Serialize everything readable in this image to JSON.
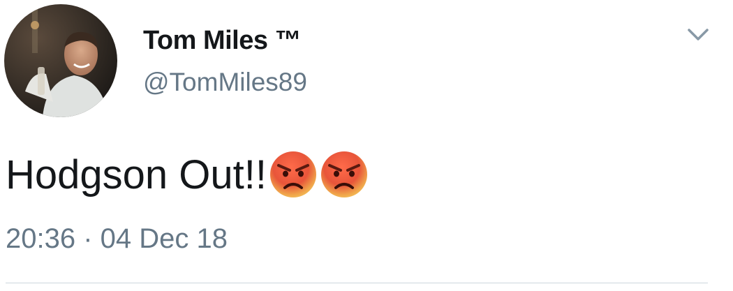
{
  "tweet": {
    "author": {
      "display_name": "Tom Miles ™",
      "username": "@TomMiles89",
      "avatar": "profile-photo"
    },
    "text": "Hodgson Out!!",
    "emojis": [
      "angry-face-icon",
      "angry-face-icon"
    ],
    "timestamp": "20:36 · 04 Dec 18",
    "menu_icon": "chevron-down-icon"
  },
  "colors": {
    "text_primary": "#14171a",
    "text_secondary": "#657786",
    "divider": "#ccd6dd",
    "emoji_face": "#e8553a"
  }
}
